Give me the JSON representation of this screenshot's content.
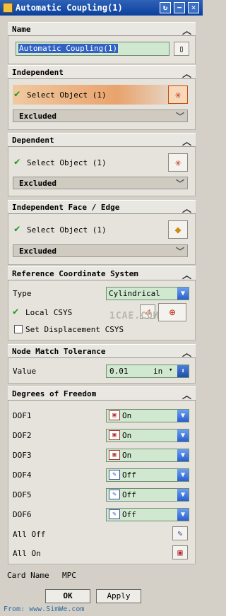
{
  "window": {
    "title": "Automatic Coupling(1)",
    "buttons": [
      "↻",
      "−",
      "✕"
    ]
  },
  "name_section": {
    "label": "Name",
    "value": "Automatic Coupling(1)"
  },
  "independent": {
    "label": "Independent",
    "select": "Select Object (1)",
    "filter": "Excluded"
  },
  "dependent": {
    "label": "Dependent",
    "select": "Select Object (1)",
    "filter": "Excluded"
  },
  "face_edge": {
    "label": "Independent Face / Edge",
    "select": "Select Object (1)",
    "filter": "Excluded"
  },
  "csys": {
    "label": "Reference Coordinate System",
    "type_label": "Type",
    "type_value": "Cylindrical",
    "local_label": "Local CSYS",
    "displacement_label": "Set Displacement CSYS"
  },
  "tolerance": {
    "label": "Node Match Tolerance",
    "value_label": "Value",
    "value": "0.01",
    "unit": "in"
  },
  "dof": {
    "label": "Degrees of Freedom",
    "rows": [
      {
        "name": "DOF1",
        "value": "On"
      },
      {
        "name": "DOF2",
        "value": "On"
      },
      {
        "name": "DOF3",
        "value": "On"
      },
      {
        "name": "DOF4",
        "value": "Off"
      },
      {
        "name": "DOF5",
        "value": "Off"
      },
      {
        "name": "DOF6",
        "value": "Off"
      }
    ],
    "all_off": "All Off",
    "all_on": "All On"
  },
  "card": {
    "label": "Card Name",
    "value": "MPC"
  },
  "buttons": {
    "ok": "OK",
    "apply": "Apply"
  },
  "watermark": {
    "text": "From: www.SimWe.com",
    "center": "1CAE.COM"
  }
}
